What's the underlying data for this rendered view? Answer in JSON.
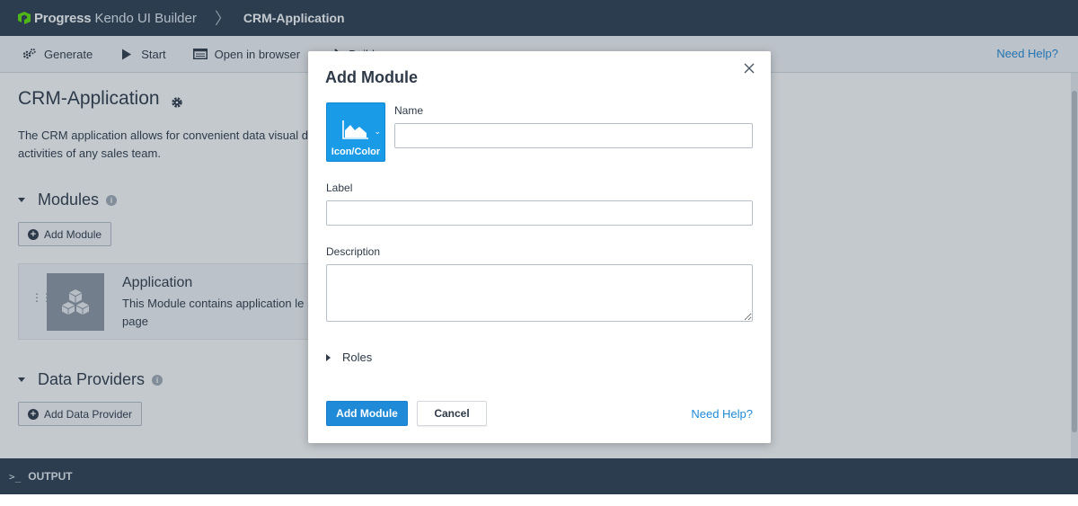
{
  "brand": {
    "name": "Progress",
    "product": "Kendo UI Builder"
  },
  "breadcrumb": {
    "current": "CRM-Application"
  },
  "toolbar": {
    "generate": "Generate",
    "start": "Start",
    "open_in_browser": "Open in browser",
    "build": "Build",
    "need_help": "Need Help?"
  },
  "page": {
    "title": "CRM-Application",
    "description": "The CRM application allows for convenient data visual day activities of any sales team.",
    "modules_heading": "Modules",
    "add_module": "Add Module",
    "data_providers_heading": "Data Providers",
    "add_data_provider": "Add Data Provider",
    "module_card": {
      "title": "Application",
      "description": "This Module contains application le page"
    }
  },
  "output_bar": {
    "label": "OUTPUT"
  },
  "modal": {
    "title": "Add Module",
    "icon_picker_label": "Icon/Color",
    "name_label": "Name",
    "name_value": "",
    "label_label": "Label",
    "label_value": "",
    "description_label": "Description",
    "description_value": "",
    "roles_label": "Roles",
    "add_button": "Add Module",
    "cancel_button": "Cancel",
    "need_help": "Need Help?"
  },
  "colors": {
    "topbar": "#2c3e50",
    "accent": "#1f8ad8",
    "icon_picker": "#1a9be8"
  },
  "icons": [
    "progress-logo-icon",
    "generate-icon",
    "play-icon",
    "browser-icon",
    "build-icon",
    "gear-icon",
    "info-icon",
    "plus-circle-icon",
    "drag-handle-icon",
    "cubes-icon",
    "terminal-icon",
    "close-icon",
    "area-chart-icon",
    "chevron-down-icon",
    "caret-right-icon"
  ]
}
